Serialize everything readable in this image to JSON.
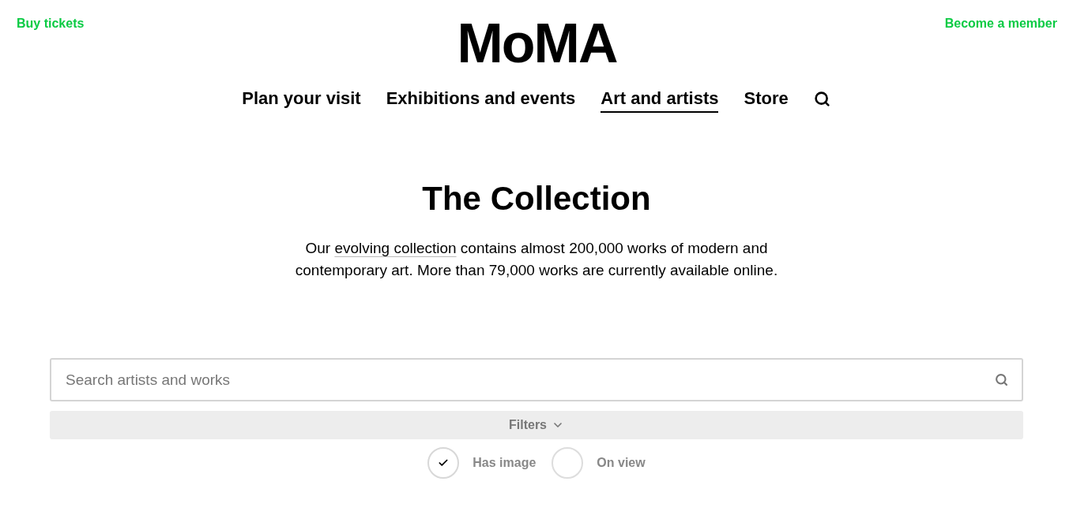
{
  "header": {
    "left_link": "Buy tickets",
    "logo": "MoMA",
    "right_link": "Become a member"
  },
  "nav": [
    {
      "label": "Plan your visit",
      "selected": false
    },
    {
      "label": "Exhibitions and events",
      "selected": false
    },
    {
      "label": "Art and artists",
      "selected": true
    },
    {
      "label": "Store",
      "selected": false
    }
  ],
  "title": "The Collection",
  "intro": {
    "before": "Our ",
    "link": "evolving collection",
    "after": " contains almost 200,000 works of modern and contemporary art. More than 79,000 works are currently available online."
  },
  "search": {
    "placeholder": "Search artists and works"
  },
  "filters": {
    "label": "Filters",
    "expanded": false
  },
  "options": [
    {
      "label": "Has image",
      "checked": true
    },
    {
      "label": "On view",
      "checked": false
    }
  ]
}
